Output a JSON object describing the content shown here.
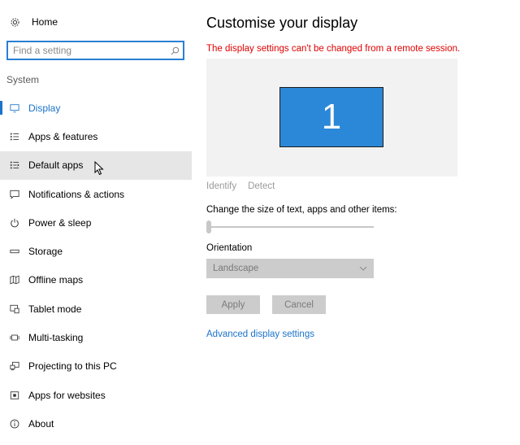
{
  "sidebar": {
    "home_label": "Home",
    "search_placeholder": "Find a setting",
    "section_label": "System",
    "items": [
      {
        "label": "Display",
        "icon": "monitor-icon"
      },
      {
        "label": "Apps & features",
        "icon": "list-icon"
      },
      {
        "label": "Default apps",
        "icon": "default-list-icon"
      },
      {
        "label": "Notifications & actions",
        "icon": "speech-bubble-icon"
      },
      {
        "label": "Power & sleep",
        "icon": "power-icon"
      },
      {
        "label": "Storage",
        "icon": "storage-icon"
      },
      {
        "label": "Offline maps",
        "icon": "map-icon"
      },
      {
        "label": "Tablet mode",
        "icon": "tablet-icon"
      },
      {
        "label": "Multi-tasking",
        "icon": "multitask-icon"
      },
      {
        "label": "Projecting to this PC",
        "icon": "project-icon"
      },
      {
        "label": "Apps for websites",
        "icon": "web-apps-icon"
      },
      {
        "label": "About",
        "icon": "info-icon"
      }
    ],
    "active_index": 0,
    "hover_index": 2
  },
  "main": {
    "title": "Customise your display",
    "warning": "The display settings can't be changed from a remote session.",
    "monitor_number": "1",
    "identify_label": "Identify",
    "detect_label": "Detect",
    "scale_label": "Change the size of text, apps and other items:",
    "scale_value_fraction": 0,
    "orientation_label": "Orientation",
    "orientation_value": "Landscape",
    "apply_label": "Apply",
    "cancel_label": "Cancel",
    "advanced_link": "Advanced display settings"
  },
  "colors": {
    "accent": "#1a73c9",
    "warning": "#e00000",
    "monitor_fill": "#2b88d8",
    "disabled_bg": "#cccccc"
  }
}
